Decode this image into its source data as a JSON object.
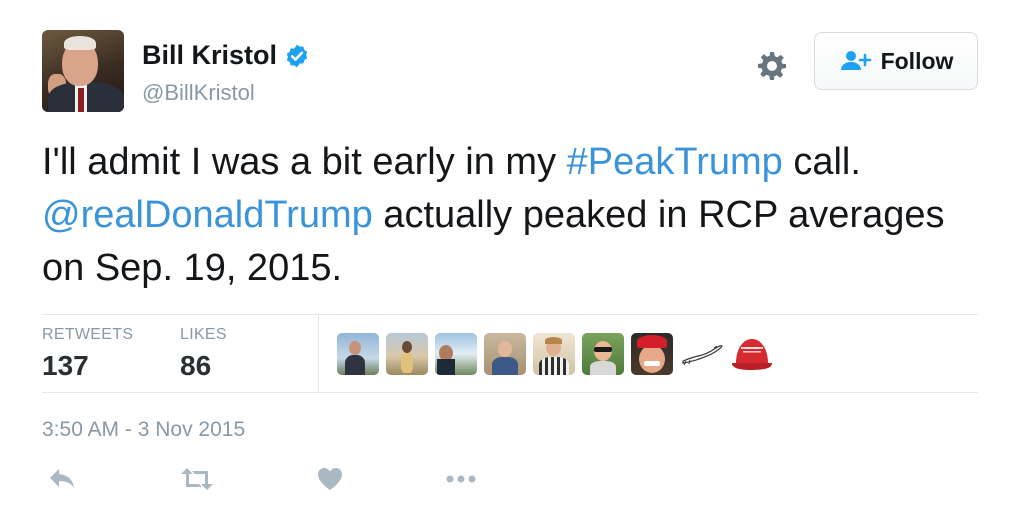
{
  "user": {
    "name": "Bill Kristol",
    "handle": "@BillKristol",
    "verified": true
  },
  "follow_button": {
    "label": "Follow"
  },
  "tweet": {
    "segments": [
      {
        "text": "I'll admit I was a bit early in my ",
        "type": "text"
      },
      {
        "text": "#PeakTrump",
        "type": "hashtag"
      },
      {
        "text": " call. ",
        "type": "text"
      },
      {
        "text": "@realDonaldTrump",
        "type": "mention"
      },
      {
        "text": " actually peaked in RCP averages on Sep. 19, 2015.",
        "type": "text"
      }
    ]
  },
  "stats": {
    "retweets_label": "RETWEETS",
    "retweets": "137",
    "likes_label": "LIKES",
    "likes": "86"
  },
  "timestamp": "3:50 AM - 3 Nov 2015",
  "actions": [
    "reply-icon",
    "retweet-icon",
    "like-icon",
    "more-icon"
  ],
  "colors": {
    "link": "#3b94d9",
    "muted": "#8899a6",
    "verified": "#1da1f2",
    "text": "#14171a"
  }
}
